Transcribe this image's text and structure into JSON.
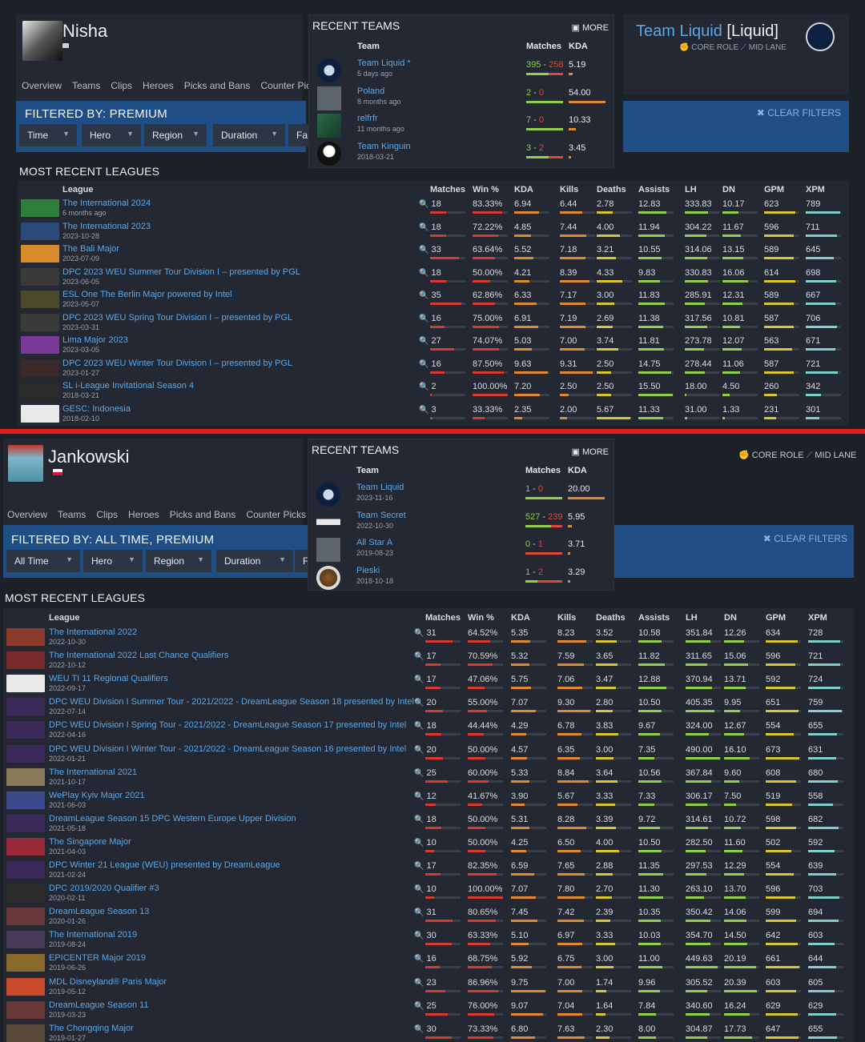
{
  "colors": {
    "win": "#8fcf4a",
    "loss": "#e0483a",
    "link": "#5aa8e8",
    "filter_bg": "#1f4e86",
    "divider": "#e01e1e",
    "bar_red": "#d63a2e",
    "bar_orange": "#e0892c",
    "bar_yellow": "#d9c52f",
    "bar_green": "#8fcf4a",
    "bar_teal": "#7fd0c8"
  },
  "top": {
    "player": {
      "name": "Nisha",
      "lock_icon": "lock-icon"
    },
    "nav": [
      "Overview",
      "Teams",
      "Clips",
      "Heroes",
      "Picks and Bans",
      "Counter Picks"
    ],
    "filter": {
      "title": "FILTERED BY: PREMIUM",
      "buttons": [
        "Time",
        "Hero",
        "Region",
        "Duration",
        "Fa"
      ],
      "clear": "CLEAR FILTERS"
    },
    "team_header": {
      "name": "Team Liquid",
      "tag": "[Liquid]",
      "role": "CORE ROLE",
      "lane": "MID LANE"
    },
    "recent_teams": {
      "title": "RECENT TEAMS",
      "more": "MORE",
      "col_team": "Team",
      "col_matches": "Matches",
      "col_kda": "KDA",
      "rows": [
        {
          "name": "Team Liquid",
          "star": "*",
          "sub": "5 days ago",
          "w": "395",
          "l": "258",
          "kda": "5.19",
          "icon": "liquid",
          "wr": 0.6,
          "kr": 0.1
        },
        {
          "name": "Poland",
          "sub": "8 months ago",
          "w": "2",
          "l": "0",
          "kda": "54.00",
          "icon": "grey",
          "wr": 1.0,
          "kr": 1.0
        },
        {
          "name": "relfrfr",
          "sub": "11 months ago",
          "w": "7",
          "l": "0",
          "kda": "10.33",
          "icon": "green",
          "wr": 1.0,
          "kr": 0.2
        },
        {
          "name": "Team Kinguin",
          "sub": "2018-03-21",
          "w": "3",
          "l": "2",
          "kda": "3.45",
          "icon": "penguin",
          "wr": 0.6,
          "kr": 0.07
        }
      ]
    },
    "leagues_title": "MOST RECENT LEAGUES",
    "headers": [
      "League",
      "Matches",
      "Win %",
      "KDA",
      "Kills",
      "Deaths",
      "Assists",
      "LH",
      "DN",
      "GPM",
      "XPM"
    ],
    "leagues": [
      {
        "name": "The International 2024",
        "date": "6 months ago",
        "c": [
          "18",
          "83.33%",
          "6.94",
          "6.44",
          "2.78",
          "12.83",
          "333.83",
          "10.17",
          "623",
          "789"
        ],
        "icon": "#2f7d3a"
      },
      {
        "name": "The International 2023",
        "date": "2023-10-28",
        "c": [
          "18",
          "72.22%",
          "4.85",
          "7.44",
          "4.00",
          "11.94",
          "304.22",
          "11.67",
          "596",
          "711"
        ],
        "icon": "#2a4a7a"
      },
      {
        "name": "The Bali Major",
        "date": "2023-07-09",
        "c": [
          "33",
          "63.64%",
          "5.52",
          "7.18",
          "3.21",
          "10.55",
          "314.06",
          "13.15",
          "589",
          "645"
        ],
        "icon": "#d98a2a"
      },
      {
        "name": "DPC 2023 WEU Summer Tour Division I – presented by PGL",
        "date": "2023-06-05",
        "c": [
          "18",
          "50.00%",
          "4.21",
          "8.39",
          "4.33",
          "9.83",
          "330.83",
          "16.06",
          "614",
          "698"
        ],
        "icon": "#3a3a3a"
      },
      {
        "name": "ESL One The Berlin Major powered by Intel",
        "date": "2023-05-07",
        "c": [
          "35",
          "62.86%",
          "6.33",
          "7.17",
          "3.00",
          "11.83",
          "285.91",
          "12.31",
          "589",
          "667"
        ],
        "icon": "#4a4a2a"
      },
      {
        "name": "DPC 2023 WEU Spring Tour Division I – presented by PGL",
        "date": "2023-03-31",
        "c": [
          "16",
          "75.00%",
          "6.91",
          "7.19",
          "2.69",
          "11.38",
          "317.56",
          "10.81",
          "587",
          "706"
        ],
        "icon": "#3a3a3a"
      },
      {
        "name": "Lima Major 2023",
        "date": "2023-03-05",
        "c": [
          "27",
          "74.07%",
          "5.03",
          "7.00",
          "3.74",
          "11.81",
          "273.78",
          "12.07",
          "563",
          "671"
        ],
        "icon": "#7a3a9a"
      },
      {
        "name": "DPC 2023 WEU Winter Tour Division I – presented by PGL",
        "date": "2023-01-27",
        "c": [
          "16",
          "87.50%",
          "9.63",
          "9.31",
          "2.50",
          "14.75",
          "278.44",
          "11.06",
          "587",
          "721"
        ],
        "icon": "#3a2a2a"
      },
      {
        "name": "SL i-League Invitational Season 4",
        "date": "2018-03-21",
        "c": [
          "2",
          "100.00%",
          "7.20",
          "2.50",
          "2.50",
          "15.50",
          "18.00",
          "4.50",
          "260",
          "342"
        ],
        "icon": "#2a2a2a"
      },
      {
        "name": "GESC: Indonesia",
        "date": "2018-02-10",
        "c": [
          "3",
          "33.33%",
          "2.35",
          "2.00",
          "5.67",
          "11.33",
          "31.00",
          "1.33",
          "231",
          "301"
        ],
        "icon": "#e8e8e8"
      }
    ]
  },
  "bottom": {
    "player": {
      "name": "Jankowski",
      "flag": "poland-flag-icon"
    },
    "nav": [
      "Overview",
      "Teams",
      "Clips",
      "Heroes",
      "Picks and Bans",
      "Counter Picks"
    ],
    "filter": {
      "title": "FILTERED BY: ALL TIME, PREMIUM",
      "buttons": [
        "All Time",
        "Hero",
        "Region",
        "Duration",
        "F"
      ],
      "clear": "CLEAR FILTERS"
    },
    "team_header": {
      "role": "CORE ROLE",
      "lane": "MID LANE"
    },
    "recent_teams": {
      "title": "RECENT TEAMS",
      "more": "MORE",
      "col_team": "Team",
      "col_matches": "Matches",
      "col_kda": "KDA",
      "rows": [
        {
          "name": "Team Liquid",
          "sub": "2023-11-16",
          "w": "1",
          "l": "0",
          "kda": "20.00",
          "icon": "liquid",
          "wr": 1.0,
          "kr": 1.0
        },
        {
          "name": "Team Secret",
          "sub": "2022-10-30",
          "w": "527",
          "l": "239",
          "kda": "5.95",
          "icon": "secret",
          "wr": 0.69,
          "kr": 0.1
        },
        {
          "name": "All Star A",
          "sub": "2019-08-23",
          "w": "0",
          "l": "1",
          "kda": "3.71",
          "icon": "grey",
          "wr": 0.0,
          "kr": 0.07
        },
        {
          "name": "Pieski",
          "sub": "2018-10-18",
          "w": "1",
          "l": "2",
          "kda": "3.29",
          "icon": "dog",
          "wr": 0.33,
          "kr": 0.06
        }
      ]
    },
    "leagues_title": "MOST RECENT LEAGUES",
    "headers": [
      "League",
      "Matches",
      "Win %",
      "KDA",
      "Kills",
      "Deaths",
      "Assists",
      "LH",
      "DN",
      "GPM",
      "XPM"
    ],
    "leagues": [
      {
        "name": "The International 2022",
        "date": "2022-10-30",
        "c": [
          "31",
          "64.52%",
          "5.35",
          "8.23",
          "3.52",
          "10.58",
          "351.84",
          "12.26",
          "634",
          "728"
        ],
        "icon": "#8a3a2a"
      },
      {
        "name": "The International 2022 Last Chance Qualifiers",
        "date": "2022-10-12",
        "c": [
          "17",
          "70.59%",
          "5.32",
          "7.59",
          "3.65",
          "11.82",
          "311.65",
          "15.06",
          "596",
          "721"
        ],
        "icon": "#7a2a2a"
      },
      {
        "name": "WEU TI 11 Regional Qualifiers",
        "date": "2022-09-17",
        "c": [
          "17",
          "47.06%",
          "5.75",
          "7.06",
          "3.47",
          "12.88",
          "370.94",
          "13.71",
          "592",
          "724"
        ],
        "icon": "#e8e8e8"
      },
      {
        "name": "DPC WEU Division I Summer Tour - 2021/2022 - DreamLeague Season 18 presented by Intel",
        "date": "2022-07-14",
        "c": [
          "20",
          "55.00%",
          "7.07",
          "9.30",
          "2.80",
          "10.50",
          "405.35",
          "9.95",
          "651",
          "759"
        ],
        "icon": "#3a2a5a"
      },
      {
        "name": "DPC WEU Division I Spring Tour - 2021/2022 - DreamLeague Season 17 presented by Intel",
        "date": "2022-04-16",
        "c": [
          "18",
          "44.44%",
          "4.29",
          "6.78",
          "3.83",
          "9.67",
          "324.00",
          "12.67",
          "554",
          "655"
        ],
        "icon": "#3a2a5a"
      },
      {
        "name": "DPC WEU Division I Winter Tour - 2021/2022 - DreamLeague Season 16 presented by Intel",
        "date": "2022-01-21",
        "c": [
          "20",
          "50.00%",
          "4.57",
          "6.35",
          "3.00",
          "7.35",
          "490.00",
          "16.10",
          "673",
          "631"
        ],
        "icon": "#3a2a5a"
      },
      {
        "name": "The International 2021",
        "date": "2021-10-17",
        "c": [
          "25",
          "60.00%",
          "5.33",
          "8.84",
          "3.64",
          "10.56",
          "367.84",
          "9.60",
          "608",
          "680"
        ],
        "icon": "#8a7a5a"
      },
      {
        "name": "WePlay Kyiv Major 2021",
        "date": "2021-06-03",
        "c": [
          "12",
          "41.67%",
          "3.90",
          "5.67",
          "3.33",
          "7.33",
          "306.17",
          "7.50",
          "519",
          "558"
        ],
        "icon": "#3a4a8a"
      },
      {
        "name": "DreamLeague Season 15 DPC Western Europe Upper Division",
        "date": "2021-05-18",
        "c": [
          "18",
          "50.00%",
          "5.31",
          "8.28",
          "3.39",
          "9.72",
          "314.61",
          "10.72",
          "598",
          "682"
        ],
        "icon": "#3a2a5a"
      },
      {
        "name": "The Singapore Major",
        "date": "2021-04-03",
        "c": [
          "10",
          "50.00%",
          "4.25",
          "6.50",
          "4.00",
          "10.50",
          "282.50",
          "11.60",
          "502",
          "592"
        ],
        "icon": "#9a2a3a"
      },
      {
        "name": "DPC Winter 21 League (WEU) presented by DreamLeague",
        "date": "2021-02-24",
        "c": [
          "17",
          "82.35%",
          "6.59",
          "7.65",
          "2.88",
          "11.35",
          "297.53",
          "12.29",
          "554",
          "639"
        ],
        "icon": "#3a2a5a"
      },
      {
        "name": "DPC 2019/2020 Qualifier #3",
        "date": "2020-02-11",
        "c": [
          "10",
          "100.00%",
          "7.07",
          "7.80",
          "2.70",
          "11.30",
          "263.10",
          "13.70",
          "596",
          "703"
        ],
        "icon": "#2a2a2a"
      },
      {
        "name": "DreamLeague Season 13",
        "date": "2020-01-26",
        "c": [
          "31",
          "80.65%",
          "7.45",
          "7.42",
          "2.39",
          "10.35",
          "350.42",
          "14.06",
          "599",
          "694"
        ],
        "icon": "#6a3a3a"
      },
      {
        "name": "The International 2019",
        "date": "2019-08-24",
        "c": [
          "30",
          "63.33%",
          "5.10",
          "6.97",
          "3.33",
          "10.03",
          "354.70",
          "14.50",
          "642",
          "603"
        ],
        "icon": "#4a3a5a"
      },
      {
        "name": "EPICENTER Major 2019",
        "date": "2019-06-26",
        "c": [
          "16",
          "68.75%",
          "5.92",
          "6.75",
          "3.00",
          "11.00",
          "449.63",
          "20.19",
          "661",
          "644"
        ],
        "icon": "#8a6a2a"
      },
      {
        "name": "MDL Disneyland® Paris Major",
        "date": "2019-05-12",
        "c": [
          "23",
          "86.96%",
          "9.75",
          "7.00",
          "1.74",
          "9.96",
          "305.52",
          "20.39",
          "603",
          "605"
        ],
        "icon": "#c84a2a"
      },
      {
        "name": "DreamLeague Season 11",
        "date": "2019-03-23",
        "c": [
          "25",
          "76.00%",
          "9.07",
          "7.04",
          "1.64",
          "7.84",
          "340.60",
          "16.24",
          "629",
          "629"
        ],
        "icon": "#6a3a3a"
      },
      {
        "name": "The Chongqing Major",
        "date": "2019-01-27",
        "c": [
          "30",
          "73.33%",
          "6.80",
          "7.63",
          "2.30",
          "8.00",
          "304.87",
          "17.73",
          "647",
          "655"
        ],
        "icon": "#5a4a3a"
      }
    ]
  }
}
